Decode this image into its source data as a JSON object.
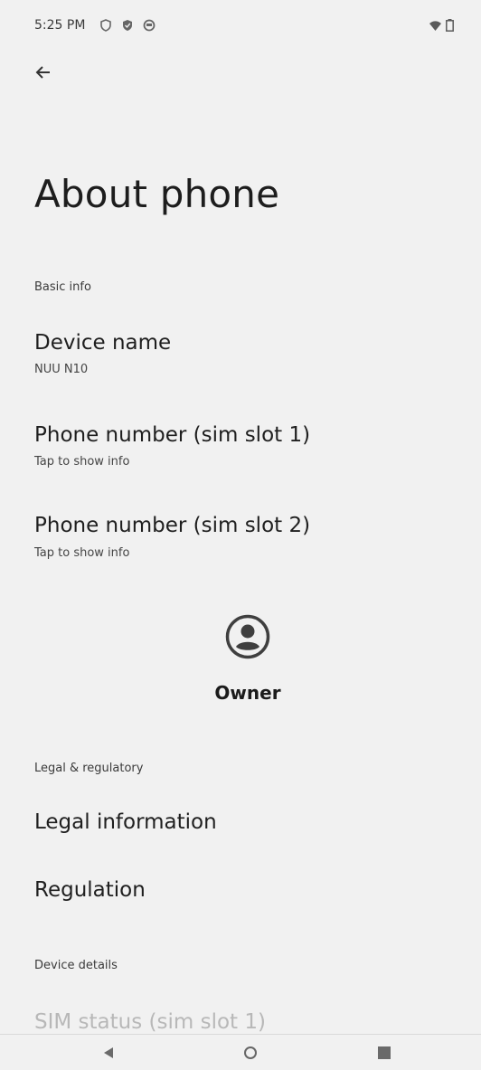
{
  "status_bar": {
    "time": "5:25 PM",
    "icons": [
      "shield-icon",
      "shield-check-icon",
      "notification-icon",
      "wifi-icon",
      "battery-icon"
    ]
  },
  "header": {
    "back_icon": "arrow-left-icon",
    "title": "About phone"
  },
  "sections": {
    "basic_info": {
      "header": "Basic info",
      "items": [
        {
          "title": "Device name",
          "summary": "NUU N10"
        },
        {
          "title": "Phone number (sim slot 1)",
          "summary": "Tap to show info"
        },
        {
          "title": "Phone number (sim slot 2)",
          "summary": "Tap to show info"
        }
      ]
    },
    "owner": {
      "label": "Owner",
      "icon": "account-circle-icon"
    },
    "legal": {
      "header": "Legal & regulatory",
      "items": [
        {
          "title": "Legal information"
        },
        {
          "title": "Regulation"
        }
      ]
    },
    "device_details": {
      "header": "Device details",
      "items": [
        {
          "title": "SIM status (sim slot 1)"
        }
      ]
    }
  },
  "nav_bar": {
    "icons": [
      "nav-back-icon",
      "nav-home-icon",
      "nav-recents-icon"
    ]
  },
  "colors": {
    "background": "#f1f1f1",
    "text": "#1f1f1f"
  }
}
